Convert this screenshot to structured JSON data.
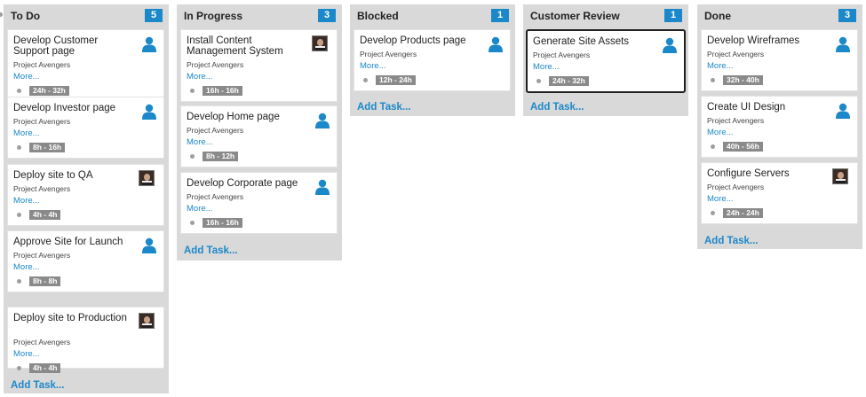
{
  "columns": [
    {
      "title": "To Do",
      "count": "5",
      "add_label": "Add Task...",
      "cards": [
        {
          "title": "Develop Customer Support page",
          "project": "Project Avengers",
          "more": "More...",
          "estimate": "24h - 32h",
          "assignee": "user-icon"
        },
        {
          "title": "Develop Investor page",
          "project": "Project Avengers",
          "more": "More...",
          "estimate": "8h - 16h",
          "assignee": "user-icon"
        },
        {
          "title": "Deploy site to QA",
          "project": "Project Avengers",
          "more": "More...",
          "estimate": "4h - 4h",
          "assignee": "avatar-photo"
        },
        {
          "title": "Approve Site for Launch",
          "project": "Project Avengers",
          "more": "More...",
          "estimate": "8h - 8h",
          "assignee": "user-icon"
        },
        {
          "title": "Deploy site to Production",
          "project": "Project Avengers",
          "more": "More...",
          "estimate": "4h - 4h",
          "assignee": "avatar-photo"
        }
      ]
    },
    {
      "title": "In Progress",
      "count": "3",
      "add_label": "Add Task...",
      "cards": [
        {
          "title": "Install Content Management System",
          "project": "Project Avengers",
          "more": "More...",
          "estimate": "16h - 16h",
          "assignee": "avatar-photo"
        },
        {
          "title": "Develop Home page",
          "project": "Project Avengers",
          "more": "More...",
          "estimate": "8h - 12h",
          "assignee": "user-icon"
        },
        {
          "title": "Develop Corporate page",
          "project": "Project Avengers",
          "more": "More...",
          "estimate": "16h - 16h",
          "assignee": "user-icon"
        }
      ]
    },
    {
      "title": "Blocked",
      "count": "1",
      "add_label": "Add Task...",
      "cards": [
        {
          "title": "Develop Products page",
          "project": "Project Avengers",
          "more": "More...",
          "estimate": "12h - 24h",
          "assignee": "user-icon"
        }
      ]
    },
    {
      "title": "Customer Review",
      "count": "1",
      "add_label": "Add Task...",
      "cards": [
        {
          "title": "Generate Site Assets",
          "project": "Project Avengers",
          "more": "More...",
          "estimate": "24h - 32h",
          "assignee": "user-icon",
          "selected": true
        }
      ]
    },
    {
      "title": "Done",
      "count": "3",
      "add_label": "Add Task...",
      "cards": [
        {
          "title": "Develop Wireframes",
          "project": "Project Avengers",
          "more": "More...",
          "estimate": "32h - 40h",
          "assignee": "user-icon"
        },
        {
          "title": "Create UI Design",
          "project": "Project Avengers",
          "more": "More...",
          "estimate": "40h - 56h",
          "assignee": "user-icon"
        },
        {
          "title": "Configure Servers",
          "project": "Project Avengers",
          "more": "More...",
          "estimate": "24h - 24h",
          "assignee": "avatar-photo"
        }
      ]
    }
  ],
  "colors": {
    "accent": "#1b88c9",
    "column_bg": "#d9d9d9",
    "estimate_badge": "#8a8a8a"
  }
}
